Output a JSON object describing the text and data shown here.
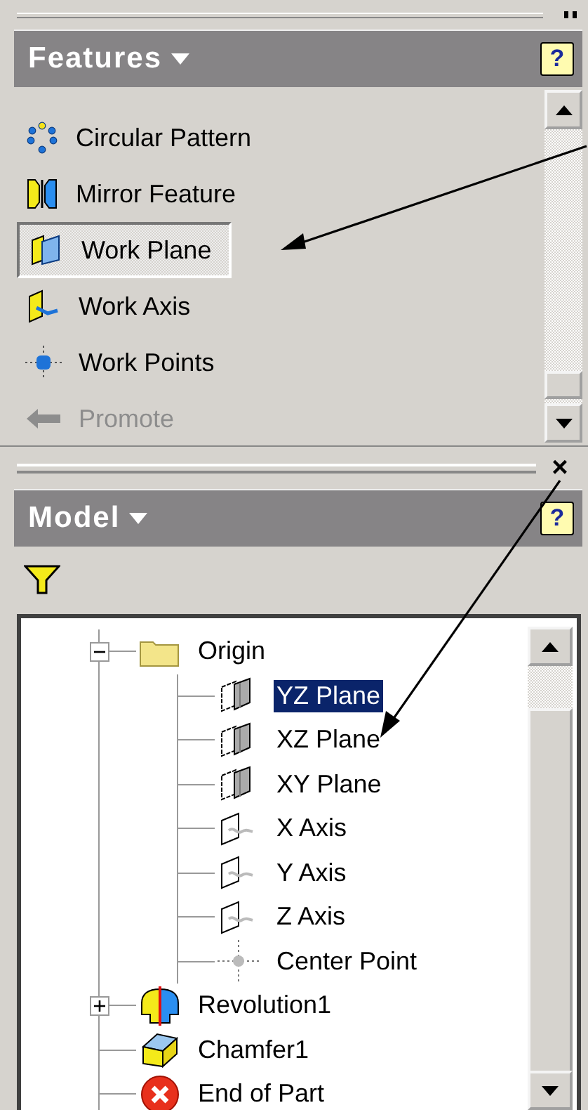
{
  "features_panel": {
    "title": "Features",
    "help": "?",
    "items": [
      {
        "label": "Circular Pattern",
        "kind": "circular-pattern",
        "selected": false,
        "disabled": false
      },
      {
        "label": "Mirror Feature",
        "kind": "mirror",
        "selected": false,
        "disabled": false
      },
      {
        "label": "Work Plane",
        "kind": "work-plane",
        "selected": true,
        "disabled": false
      },
      {
        "label": "Work Axis",
        "kind": "work-axis",
        "selected": false,
        "disabled": false
      },
      {
        "label": "Work Points",
        "kind": "work-point",
        "selected": false,
        "disabled": false
      },
      {
        "label": "Promote",
        "kind": "promote",
        "selected": false,
        "disabled": true
      }
    ]
  },
  "splitter": {
    "close": "×"
  },
  "model_panel": {
    "title": "Model",
    "help": "?",
    "tree": [
      {
        "label": "Origin",
        "kind": "folder",
        "expanded": true,
        "selected": false,
        "children": [
          {
            "label": "YZ Plane",
            "kind": "plane",
            "selected": true
          },
          {
            "label": "XZ Plane",
            "kind": "plane",
            "selected": false
          },
          {
            "label": "XY Plane",
            "kind": "plane",
            "selected": false
          },
          {
            "label": "X Axis",
            "kind": "axis",
            "selected": false
          },
          {
            "label": "Y Axis",
            "kind": "axis",
            "selected": false
          },
          {
            "label": "Z Axis",
            "kind": "axis",
            "selected": false
          },
          {
            "label": "Center Point",
            "kind": "point",
            "selected": false
          }
        ]
      },
      {
        "label": "Revolution1",
        "kind": "revolution",
        "expanded": false,
        "selected": false
      },
      {
        "label": "Chamfer1",
        "kind": "chamfer",
        "selected": false
      },
      {
        "label": "End of Part",
        "kind": "end",
        "selected": false
      }
    ]
  }
}
